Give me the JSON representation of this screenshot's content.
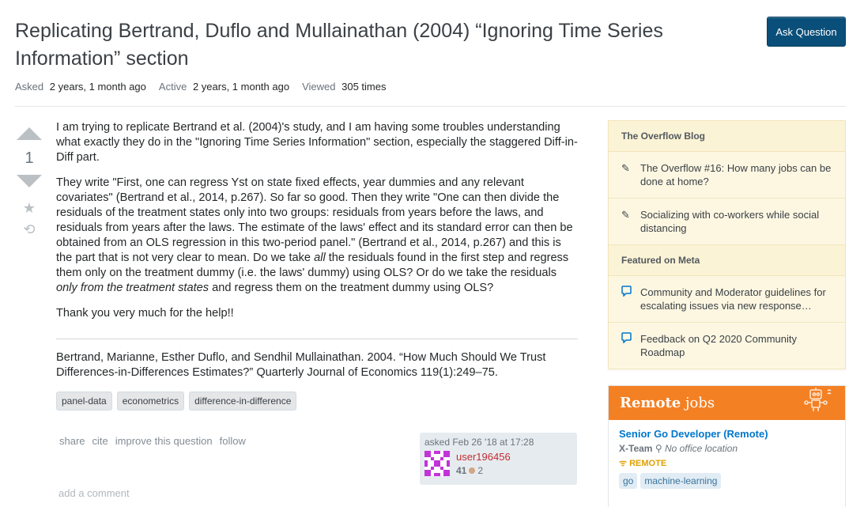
{
  "question": {
    "title": "Replicating Bertrand, Duflo and Mullainathan (2004) “Ignoring Time Series Information” section",
    "ask_button": "Ask Question",
    "meta": {
      "asked_label": "Asked",
      "asked_value": "2 years, 1 month ago",
      "active_label": "Active",
      "active_value": "2 years, 1 month ago",
      "viewed_label": "Viewed",
      "viewed_value": "305 times"
    },
    "votes": "1",
    "body": {
      "p1": "I am trying to replicate Bertrand et al. (2004)'s study, and I am having some troubles understanding what exactly they do in the \"Ignoring Time Series Information\" section, especially the staggered Diff-in-Diff part.",
      "p2_a": "They write \"First, one can regress Yst on state fixed effects, year dummies and any relevant covariates\" (Bertrand et al., 2014, p.267). So far so good. Then they write \"One can then divide the residuals of the treatment states only into two groups: residuals from years before the laws, and residuals from years after the laws. The estimate of the laws' effect and its standard error can then be obtained from an OLS regression in this two-period panel.\" (Bertrand et al., 2014, p.267) and this is the part that is not very clear to mean. Do we take ",
      "p2_em1": "all",
      "p2_b": " the residuals found in the first step and regress them only on the treatment dummy (i.e. the laws' dummy) using OLS? Or do we take the residuals ",
      "p2_em2": "only from the treatment states",
      "p2_c": " and regress them on the treatment dummy using OLS?",
      "p3": "Thank you very much for the help!!",
      "ref": "Bertrand, Marianne, Esther Duflo, and Sendhil Mullainathan. 2004. “How Much Should We Trust Differences-in-Differences Estimates?” Quarterly Journal of Economics 119(1):249–75."
    },
    "tags": [
      "panel-data",
      "econometrics",
      "difference-in-difference"
    ],
    "menu": {
      "share": "share",
      "cite": "cite",
      "improve": "improve this question",
      "follow": "follow"
    },
    "owner": {
      "asked": "asked Feb 26 '18 at 17:28",
      "name": "user196456",
      "reputation": "41",
      "bronze": "2"
    },
    "add_comment": "add a comment"
  },
  "sidebar": {
    "blog_header": "The Overflow Blog",
    "blog_items": [
      "The Overflow #16: How many jobs can be done at home?",
      "Socializing with co-workers while social distancing"
    ],
    "meta_header": "Featured on Meta",
    "meta_items": [
      "Community and Moderator guidelines for escalating issues via new response…",
      "Feedback on Q2 2020 Community Roadmap"
    ]
  },
  "jobs": {
    "header_bold": "Remote",
    "header_rest": " jobs",
    "title": "Senior Go Developer (Remote)",
    "company": "X-Team",
    "location": "No office location",
    "remote": "REMOTE",
    "tags": [
      "go",
      "machine-learning"
    ]
  }
}
